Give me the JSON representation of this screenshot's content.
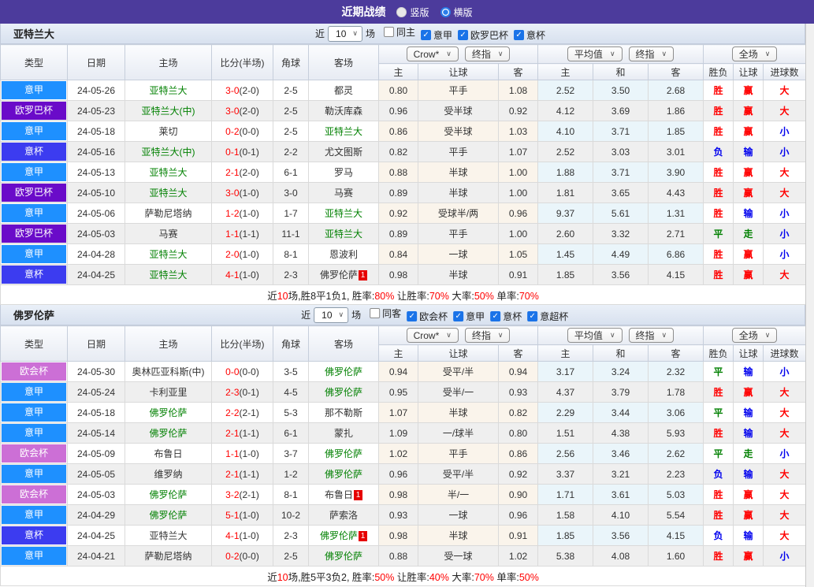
{
  "colors": {
    "topbar": "#4C3B9C",
    "serie_a_badge": "#1E90FF",
    "europa_badge": "#6A0BC9",
    "coppa_badge": "#3C3CF0",
    "conference_badge": "#CC6FD6",
    "focus_team": "#008000",
    "win": "#FF0000",
    "lose": "#0000EE",
    "draw": "#008000"
  },
  "titlebar": {
    "title": "近期战绩",
    "radio_vertical": "竖版",
    "radio_horizontal": "横版"
  },
  "columns": {
    "type": "类型",
    "date": "日期",
    "home": "主场",
    "score": "比分(半场)",
    "corner": "角球",
    "away": "客场",
    "odds_home": "主",
    "handicap": "让球",
    "odds_away": "客",
    "avg_home": "主",
    "avg_draw": "和",
    "avg_away": "客",
    "result": "胜负",
    "handicap_result": "让球",
    "goals": "进球数"
  },
  "dropdowns": {
    "crow": "Crow*",
    "final_a": "终指",
    "average": "平均值",
    "final_b": "终指",
    "full_match": "全场"
  },
  "sections": [
    {
      "team": "亚特兰大",
      "filter": {
        "near": "近",
        "count": "10",
        "matches": "场",
        "checkboxes": [
          {
            "label": "同主",
            "checked": false
          },
          {
            "label": "意甲",
            "checked": true
          },
          {
            "label": "欧罗巴杯",
            "checked": true
          },
          {
            "label": "意杯",
            "checked": true
          }
        ]
      },
      "rows": [
        {
          "league": "意甲",
          "league_color": "blue",
          "date": "24-05-26",
          "home": "亚特兰大",
          "home_focus": true,
          "score": "3-0",
          "half": "(2-0)",
          "corner": "2-5",
          "away": "都灵",
          "odds_home": "0.80",
          "handicap": "平手",
          "odds_away": "1.08",
          "avg_home": "2.52",
          "avg_draw": "3.50",
          "avg_away": "2.68",
          "result": "胜",
          "result_color": "red",
          "hcp_result": "赢",
          "hcp_color": "red",
          "goals": "大",
          "goals_color": "red"
        },
        {
          "league": "欧罗巴杯",
          "league_color": "purple",
          "date": "24-05-23",
          "home": "亚特兰大(中)",
          "home_focus": true,
          "score": "3-0",
          "half": "(2-0)",
          "corner": "2-5",
          "away": "勒沃库森",
          "odds_home": "0.96",
          "handicap": "受半球",
          "odds_away": "0.92",
          "avg_home": "4.12",
          "avg_draw": "3.69",
          "avg_away": "1.86",
          "result": "胜",
          "result_color": "red",
          "hcp_result": "赢",
          "hcp_color": "red",
          "goals": "大",
          "goals_color": "red"
        },
        {
          "league": "意甲",
          "league_color": "blue",
          "date": "24-05-18",
          "home": "莱切",
          "score": "0-2",
          "half": "(0-0)",
          "corner": "2-5",
          "away": "亚特兰大",
          "away_focus": true,
          "odds_home": "0.86",
          "handicap": "受半球",
          "odds_away": "1.03",
          "avg_home": "4.10",
          "avg_draw": "3.71",
          "avg_away": "1.85",
          "result": "胜",
          "result_color": "red",
          "hcp_result": "赢",
          "hcp_color": "red",
          "goals": "小",
          "goals_color": "blue"
        },
        {
          "league": "意杯",
          "league_color": "violet",
          "date": "24-05-16",
          "home": "亚特兰大(中)",
          "home_focus": true,
          "score": "0-1",
          "half": "(0-1)",
          "corner": "2-2",
          "away": "尤文图斯",
          "odds_home": "0.82",
          "handicap": "平手",
          "odds_away": "1.07",
          "avg_home": "2.52",
          "avg_draw": "3.03",
          "avg_away": "3.01",
          "result": "负",
          "result_color": "blue",
          "hcp_result": "输",
          "hcp_color": "blue",
          "goals": "小",
          "goals_color": "blue"
        },
        {
          "league": "意甲",
          "league_color": "blue",
          "date": "24-05-13",
          "home": "亚特兰大",
          "home_focus": true,
          "score": "2-1",
          "half": "(2-0)",
          "corner": "6-1",
          "away": "罗马",
          "odds_home": "0.88",
          "handicap": "半球",
          "odds_away": "1.00",
          "avg_home": "1.88",
          "avg_draw": "3.71",
          "avg_away": "3.90",
          "result": "胜",
          "result_color": "red",
          "hcp_result": "赢",
          "hcp_color": "red",
          "goals": "大",
          "goals_color": "red"
        },
        {
          "league": "欧罗巴杯",
          "league_color": "purple",
          "date": "24-05-10",
          "home": "亚特兰大",
          "home_focus": true,
          "score": "3-0",
          "half": "(1-0)",
          "corner": "3-0",
          "away": "马赛",
          "odds_home": "0.89",
          "handicap": "半球",
          "odds_away": "1.00",
          "avg_home": "1.81",
          "avg_draw": "3.65",
          "avg_away": "4.43",
          "result": "胜",
          "result_color": "red",
          "hcp_result": "赢",
          "hcp_color": "red",
          "goals": "大",
          "goals_color": "red"
        },
        {
          "league": "意甲",
          "league_color": "blue",
          "date": "24-05-06",
          "home": "萨勒尼塔纳",
          "score": "1-2",
          "half": "(1-0)",
          "corner": "1-7",
          "away": "亚特兰大",
          "away_focus": true,
          "odds_home": "0.92",
          "handicap": "受球半/两",
          "odds_away": "0.96",
          "avg_home": "9.37",
          "avg_draw": "5.61",
          "avg_away": "1.31",
          "result": "胜",
          "result_color": "red",
          "hcp_result": "输",
          "hcp_color": "blue",
          "goals": "小",
          "goals_color": "blue"
        },
        {
          "league": "欧罗巴杯",
          "league_color": "purple",
          "date": "24-05-03",
          "home": "马赛",
          "score": "1-1",
          "half": "(1-1)",
          "corner": "11-1",
          "away": "亚特兰大",
          "away_focus": true,
          "odds_home": "0.89",
          "handicap": "平手",
          "odds_away": "1.00",
          "avg_home": "2.60",
          "avg_draw": "3.32",
          "avg_away": "2.71",
          "result": "平",
          "result_color": "green",
          "hcp_result": "走",
          "hcp_color": "green",
          "goals": "小",
          "goals_color": "blue"
        },
        {
          "league": "意甲",
          "league_color": "blue",
          "date": "24-04-28",
          "home": "亚特兰大",
          "home_focus": true,
          "score": "2-0",
          "half": "(1-0)",
          "corner": "8-1",
          "away": "恩波利",
          "odds_home": "0.84",
          "handicap": "一球",
          "odds_away": "1.05",
          "avg_home": "1.45",
          "avg_draw": "4.49",
          "avg_away": "6.86",
          "result": "胜",
          "result_color": "red",
          "hcp_result": "赢",
          "hcp_color": "red",
          "goals": "小",
          "goals_color": "blue"
        },
        {
          "league": "意杯",
          "league_color": "violet",
          "date": "24-04-25",
          "home": "亚特兰大",
          "home_focus": true,
          "score": "4-1",
          "half": "(1-0)",
          "corner": "2-3",
          "away": "佛罗伦萨",
          "away_card": "1",
          "odds_home": "0.98",
          "handicap": "半球",
          "odds_away": "0.91",
          "avg_home": "1.85",
          "avg_draw": "3.56",
          "avg_away": "4.15",
          "result": "胜",
          "result_color": "red",
          "hcp_result": "赢",
          "hcp_color": "red",
          "goals": "大",
          "goals_color": "red"
        }
      ],
      "summary": [
        {
          "text": "近"
        },
        {
          "text": "10",
          "red": true
        },
        {
          "text": "场,胜8平1负1, 胜率:"
        },
        {
          "text": "80%",
          "red": true
        },
        {
          "text": " 让胜率:"
        },
        {
          "text": "70%",
          "red": true
        },
        {
          "text": " 大率:"
        },
        {
          "text": "50%",
          "red": true
        },
        {
          "text": " 单率:"
        },
        {
          "text": "70%",
          "red": true
        }
      ]
    },
    {
      "team": "佛罗伦萨",
      "filter": {
        "near": "近",
        "count": "10",
        "matches": "场",
        "checkboxes": [
          {
            "label": "同客",
            "checked": false
          },
          {
            "label": "欧会杯",
            "checked": true
          },
          {
            "label": "意甲",
            "checked": true
          },
          {
            "label": "意杯",
            "checked": true
          },
          {
            "label": "意超杯",
            "checked": true
          }
        ]
      },
      "rows": [
        {
          "league": "欧会杯",
          "league_color": "pink",
          "date": "24-05-30",
          "home": "奥林匹亚科斯(中)",
          "score": "0-0",
          "half": "(0-0)",
          "corner": "3-5",
          "away": "佛罗伦萨",
          "away_focus": true,
          "odds_home": "0.94",
          "handicap": "受平/半",
          "odds_away": "0.94",
          "avg_home": "3.17",
          "avg_draw": "3.24",
          "avg_away": "2.32",
          "result": "平",
          "result_color": "green",
          "hcp_result": "输",
          "hcp_color": "blue",
          "goals": "小",
          "goals_color": "blue"
        },
        {
          "league": "意甲",
          "league_color": "blue",
          "date": "24-05-24",
          "home": "卡利亚里",
          "score": "2-3",
          "half": "(0-1)",
          "corner": "4-5",
          "away": "佛罗伦萨",
          "away_focus": true,
          "odds_home": "0.95",
          "handicap": "受半/一",
          "odds_away": "0.93",
          "avg_home": "4.37",
          "avg_draw": "3.79",
          "avg_away": "1.78",
          "result": "胜",
          "result_color": "red",
          "hcp_result": "赢",
          "hcp_color": "red",
          "goals": "大",
          "goals_color": "red"
        },
        {
          "league": "意甲",
          "league_color": "blue",
          "date": "24-05-18",
          "home": "佛罗伦萨",
          "home_focus": true,
          "score": "2-2",
          "half": "(2-1)",
          "corner": "5-3",
          "away": "那不勒斯",
          "odds_home": "1.07",
          "handicap": "半球",
          "odds_away": "0.82",
          "avg_home": "2.29",
          "avg_draw": "3.44",
          "avg_away": "3.06",
          "result": "平",
          "result_color": "green",
          "hcp_result": "输",
          "hcp_color": "blue",
          "goals": "大",
          "goals_color": "red"
        },
        {
          "league": "意甲",
          "league_color": "blue",
          "date": "24-05-14",
          "home": "佛罗伦萨",
          "home_focus": true,
          "score": "2-1",
          "half": "(1-1)",
          "corner": "6-1",
          "away": "蒙扎",
          "odds_home": "1.09",
          "handicap": "一/球半",
          "odds_away": "0.80",
          "avg_home": "1.51",
          "avg_draw": "4.38",
          "avg_away": "5.93",
          "result": "胜",
          "result_color": "red",
          "hcp_result": "输",
          "hcp_color": "blue",
          "goals": "大",
          "goals_color": "red"
        },
        {
          "league": "欧会杯",
          "league_color": "pink",
          "date": "24-05-09",
          "home": "布鲁日",
          "score": "1-1",
          "half": "(1-0)",
          "corner": "3-7",
          "away": "佛罗伦萨",
          "away_focus": true,
          "odds_home": "1.02",
          "handicap": "平手",
          "odds_away": "0.86",
          "avg_home": "2.56",
          "avg_draw": "3.46",
          "avg_away": "2.62",
          "result": "平",
          "result_color": "green",
          "hcp_result": "走",
          "hcp_color": "green",
          "goals": "小",
          "goals_color": "blue"
        },
        {
          "league": "意甲",
          "league_color": "blue",
          "date": "24-05-05",
          "home": "维罗纳",
          "score": "2-1",
          "half": "(1-1)",
          "corner": "1-2",
          "away": "佛罗伦萨",
          "away_focus": true,
          "odds_home": "0.96",
          "handicap": "受平/半",
          "odds_away": "0.92",
          "avg_home": "3.37",
          "avg_draw": "3.21",
          "avg_away": "2.23",
          "result": "负",
          "result_color": "blue",
          "hcp_result": "输",
          "hcp_color": "blue",
          "goals": "大",
          "goals_color": "red"
        },
        {
          "league": "欧会杯",
          "league_color": "pink",
          "date": "24-05-03",
          "home": "佛罗伦萨",
          "home_focus": true,
          "score": "3-2",
          "half": "(2-1)",
          "corner": "8-1",
          "away": "布鲁日",
          "away_card": "1",
          "odds_home": "0.98",
          "handicap": "半/一",
          "odds_away": "0.90",
          "avg_home": "1.71",
          "avg_draw": "3.61",
          "avg_away": "5.03",
          "result": "胜",
          "result_color": "red",
          "hcp_result": "赢",
          "hcp_color": "red",
          "goals": "大",
          "goals_color": "red"
        },
        {
          "league": "意甲",
          "league_color": "blue",
          "date": "24-04-29",
          "home": "佛罗伦萨",
          "home_focus": true,
          "score": "5-1",
          "half": "(1-0)",
          "corner": "10-2",
          "away": "萨索洛",
          "odds_home": "0.93",
          "handicap": "一球",
          "odds_away": "0.96",
          "avg_home": "1.58",
          "avg_draw": "4.10",
          "avg_away": "5.54",
          "result": "胜",
          "result_color": "red",
          "hcp_result": "赢",
          "hcp_color": "red",
          "goals": "大",
          "goals_color": "red"
        },
        {
          "league": "意杯",
          "league_color": "violet",
          "date": "24-04-25",
          "home": "亚特兰大",
          "score": "4-1",
          "half": "(1-0)",
          "corner": "2-3",
          "away": "佛罗伦萨",
          "away_focus": true,
          "away_card": "1",
          "odds_home": "0.98",
          "handicap": "半球",
          "odds_away": "0.91",
          "avg_home": "1.85",
          "avg_draw": "3.56",
          "avg_away": "4.15",
          "result": "负",
          "result_color": "blue",
          "hcp_result": "输",
          "hcp_color": "blue",
          "goals": "大",
          "goals_color": "red"
        },
        {
          "league": "意甲",
          "league_color": "blue",
          "date": "24-04-21",
          "home": "萨勒尼塔纳",
          "score": "0-2",
          "half": "(0-0)",
          "corner": "2-5",
          "away": "佛罗伦萨",
          "away_focus": true,
          "odds_home": "0.88",
          "handicap": "受一球",
          "odds_away": "1.02",
          "avg_home": "5.38",
          "avg_draw": "4.08",
          "avg_away": "1.60",
          "result": "胜",
          "result_color": "red",
          "hcp_result": "赢",
          "hcp_color": "red",
          "goals": "小",
          "goals_color": "blue"
        }
      ],
      "summary": [
        {
          "text": "近"
        },
        {
          "text": "10",
          "red": true
        },
        {
          "text": "场,胜5平3负2, 胜率:"
        },
        {
          "text": "50%",
          "red": true
        },
        {
          "text": " 让胜率:"
        },
        {
          "text": "40%",
          "red": true
        },
        {
          "text": " 大率:"
        },
        {
          "text": "70%",
          "red": true
        },
        {
          "text": " 单率:"
        },
        {
          "text": "50%",
          "red": true
        }
      ]
    }
  ]
}
